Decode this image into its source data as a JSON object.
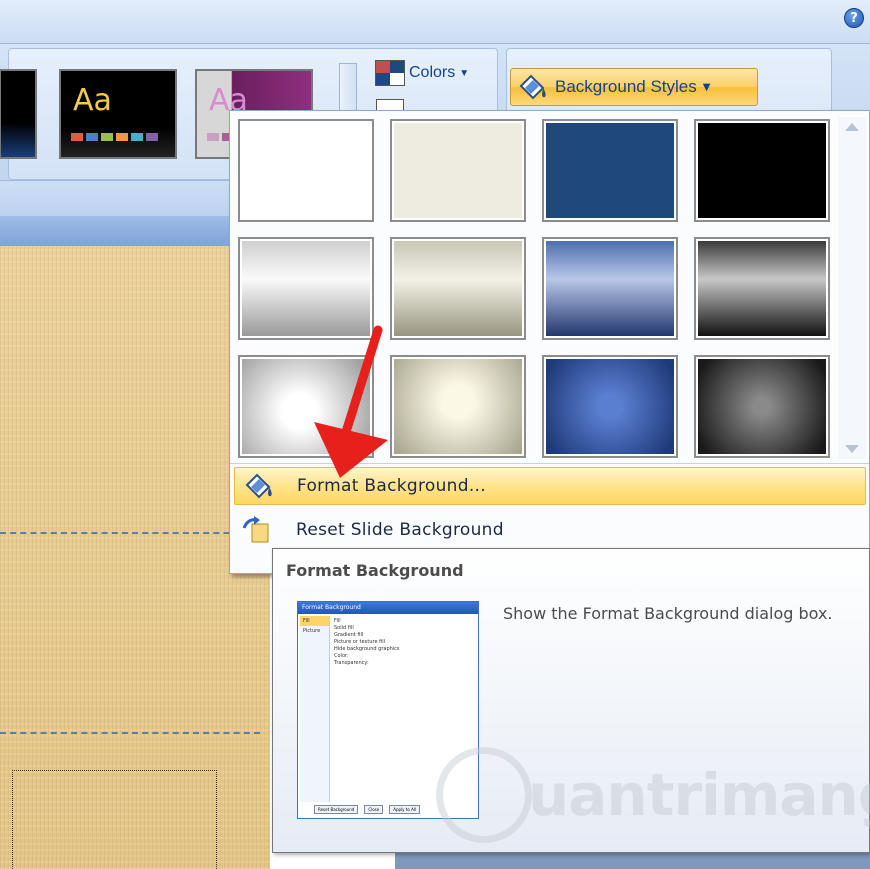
{
  "ribbon": {
    "help_icon": "help-icon",
    "help_glyph": "?",
    "themes": [
      {
        "sample_text": "",
        "bg": "#000000",
        "text_color": "#f3c84b"
      },
      {
        "sample_text": "Aa",
        "bg": "#000000",
        "text_color": "#f3c84b"
      },
      {
        "sample_text": "Aa",
        "bg": "#7a2a6a",
        "text_color": "#d98ad0"
      }
    ],
    "colors_label": "Colors",
    "fonts_label": "",
    "background_styles_label": "Background Styles"
  },
  "gallery": {
    "styles": [
      {
        "name": "style-1",
        "fill": "#ffffff"
      },
      {
        "name": "style-2",
        "fill": "#eeece1"
      },
      {
        "name": "style-3",
        "fill": "#1f497d"
      },
      {
        "name": "style-4",
        "fill": "#000000"
      },
      {
        "name": "style-5",
        "fill": "gradient-gray"
      },
      {
        "name": "style-6",
        "fill": "gradient-tan"
      },
      {
        "name": "style-7",
        "fill": "gradient-blue"
      },
      {
        "name": "style-8",
        "fill": "gradient-black"
      },
      {
        "name": "style-9",
        "fill": "radial-gray"
      },
      {
        "name": "style-10",
        "fill": "radial-tan"
      },
      {
        "name": "style-11",
        "fill": "radial-blue"
      },
      {
        "name": "style-12",
        "fill": "radial-black"
      }
    ]
  },
  "menu": {
    "format_background": "Format Background...",
    "reset_slide_background": "Reset Slide Background"
  },
  "tooltip": {
    "title": "Format Background",
    "description": "Show the Format Background dialog box.",
    "preview": {
      "dialog_title": "Format Background",
      "sidebar": [
        "Fill",
        "Picture"
      ],
      "body_lines": [
        "Fill",
        "Solid fill",
        "Gradient fill",
        "Picture or texture fill",
        "Hide background graphics",
        "Color:",
        "Transparency:"
      ],
      "buttons": [
        "Reset Background",
        "Close",
        "Apply to All"
      ]
    }
  },
  "watermark": "uantrimang",
  "colors": {
    "highlight": "#ffd764",
    "ribbon": "#c6d9f1",
    "arrow": "#e8201c"
  }
}
